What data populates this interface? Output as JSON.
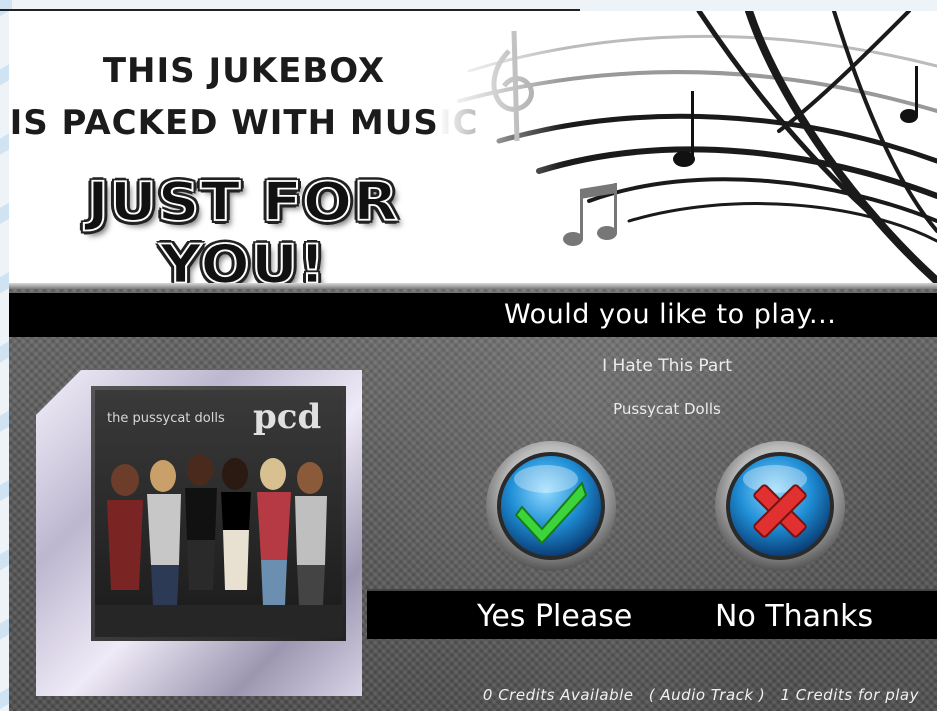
{
  "banner": {
    "line1": "THIS JUKEBOX",
    "line2": "IS PACKED WITH MUSIC",
    "line3": "JUST FOR YOU!"
  },
  "prompt": "Would you like to play...",
  "song": {
    "title": "I Hate This Part",
    "artist": "Pussycat Dolls"
  },
  "album_cover": {
    "band_text": "the pussycat dolls",
    "logo_text": "pcd"
  },
  "buttons": {
    "yes_label": "Yes Please",
    "no_label": "No Thanks",
    "yes_icon": "check-icon",
    "no_icon": "cross-icon"
  },
  "footer": {
    "credits_available": "0 Credits Available",
    "track_type": "( Audio Track )",
    "credits_for_play": "1 Credits for play"
  },
  "colors": {
    "button_blue": "#1f8fd6",
    "check_green": "#3bd43b",
    "cross_red": "#e0302f"
  }
}
